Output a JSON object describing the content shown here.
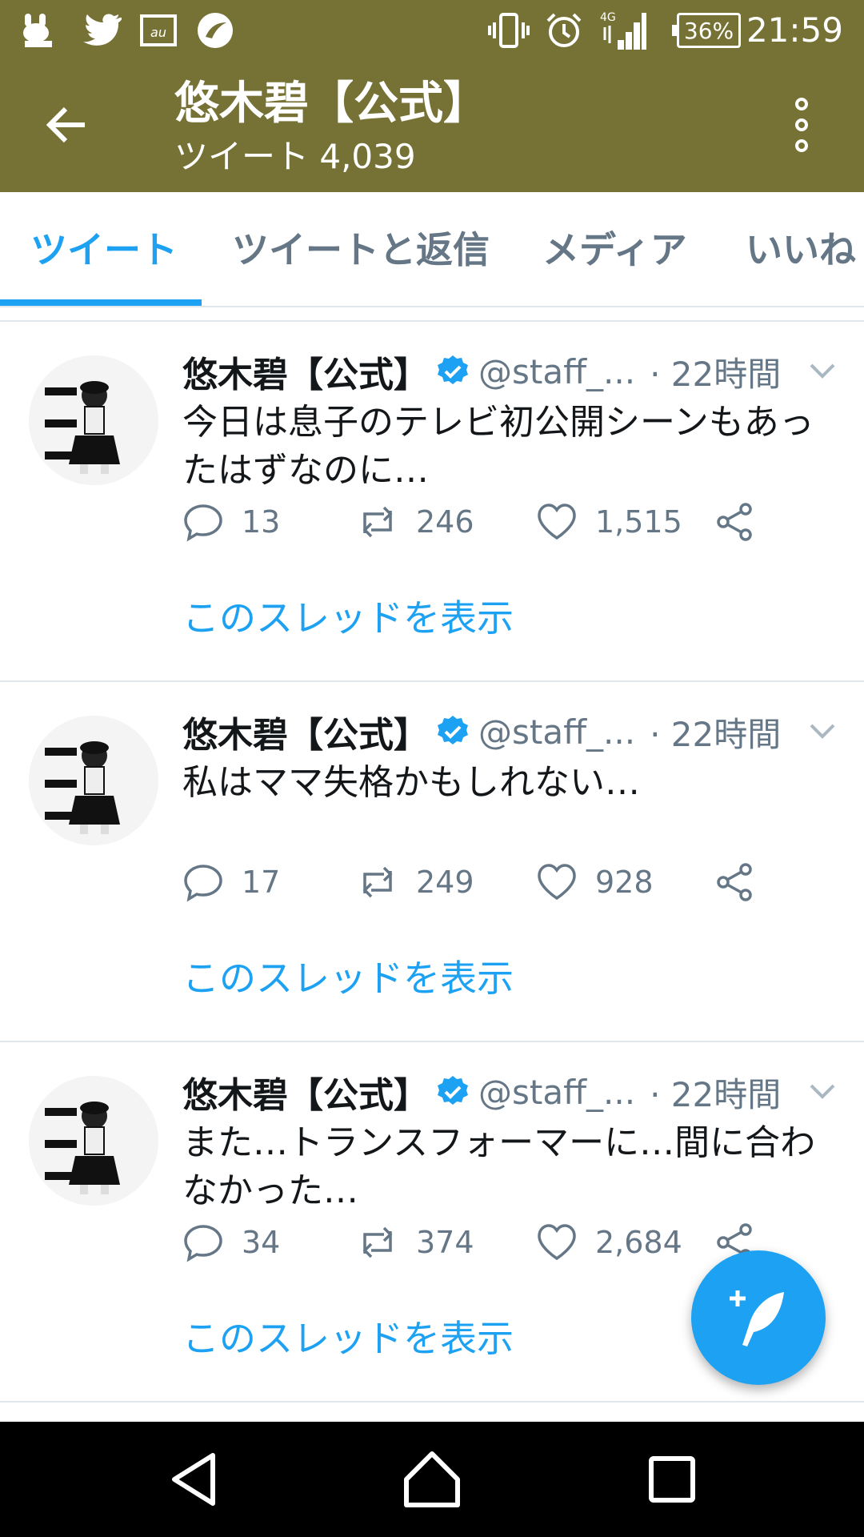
{
  "status_bar": {
    "time": "21:59",
    "battery": "36%",
    "network": "4G",
    "icons": [
      "app-icon",
      "twitter-icon",
      "au-icon",
      "app-icon-2",
      "vibrate-icon",
      "alarm-icon",
      "signal-icon",
      "battery-icon"
    ]
  },
  "header": {
    "title": "悠木碧【公式】",
    "subtitle": "ツイート 4,039"
  },
  "tabs": [
    {
      "label": "ツイート",
      "active": true
    },
    {
      "label": "ツイートと返信",
      "active": false
    },
    {
      "label": "メディア",
      "active": false
    },
    {
      "label": "いいね",
      "active": false
    }
  ],
  "tweets": [
    {
      "name": "悠木碧【公式】",
      "handle": "@staff_...",
      "time": "· 22時間",
      "text": "今日は息子のテレビ初公開シーンもあったはずなのに…",
      "replies": "13",
      "retweets": "246",
      "likes": "1,515",
      "thread_label": "このスレッドを表示"
    },
    {
      "name": "悠木碧【公式】",
      "handle": "@staff_...",
      "time": "· 22時間",
      "text": "私はママ失格かもしれない…",
      "replies": "17",
      "retweets": "249",
      "likes": "928",
      "thread_label": "このスレッドを表示"
    },
    {
      "name": "悠木碧【公式】",
      "handle": "@staff_...",
      "time": "· 22時間",
      "text": "また…トランスフォーマーに…間に合わなかった…",
      "replies": "34",
      "retweets": "374",
      "likes": "2,684",
      "thread_label": "このスレッドを表示"
    }
  ],
  "colors": {
    "header_bg": "#767235",
    "accent": "#1da1f2",
    "muted": "#657786"
  }
}
